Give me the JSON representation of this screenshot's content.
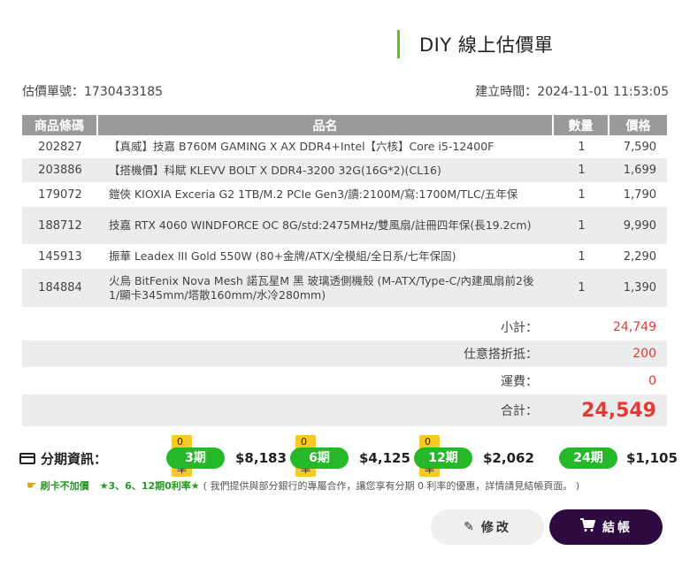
{
  "header": {
    "title": "DIY 線上估價單"
  },
  "quote": {
    "number": "估價單號：1730433185",
    "created": "建立時間：2024-11-01 11:53:05"
  },
  "table": {
    "columns": [
      "商品條碼",
      "品名",
      "數量",
      "價格"
    ],
    "rows": [
      {
        "code": "202827",
        "name": "【真威】技嘉 B760M GAMING X AX DDR4+Intel【六核】Core i5-12400F",
        "qty": "1",
        "price": "7,590"
      },
      {
        "code": "203886",
        "name": "【搭機價】科賦 KLEVV BOLT X DDR4-3200 32G(16G*2)(CL16)",
        "qty": "1",
        "price": "1,699"
      },
      {
        "code": "179072",
        "name": "鎧俠 KIOXIA Exceria G2 1TB/M.2 PCIe Gen3/讀:2100M/寫:1700M/TLC/五年保",
        "qty": "1",
        "price": "1,790"
      },
      {
        "code": "188712",
        "name": "技嘉 RTX 4060 WINDFORCE OC 8G/std:2475MHz/雙風扇/註冊四年保(長19.2cm)",
        "qty": "1",
        "price": "9,990"
      },
      {
        "code": "145913",
        "name": "振華 Leadex III Gold 550W (80+金牌/ATX/全模組/全日系/七年保固)",
        "qty": "1",
        "price": "2,290"
      },
      {
        "code": "184884",
        "name": "火鳥 BitFenix Nova Mesh 諾瓦星M 黑 玻璃透側機殼 (M-ATX/Type-C/內建風扇前2後1/顯卡345mm/塔散160mm/水冷280mm)",
        "qty": "1",
        "price": "1,390"
      }
    ]
  },
  "summary": {
    "subtotal_label": "小計：",
    "subtotal": "24,749",
    "discount_label": "仕意搭折抵：",
    "discount": "200",
    "shipping_label": "運費：",
    "shipping": "0",
    "total_label": "合計：",
    "total": "24,549"
  },
  "installment": {
    "label": "分期資訊：",
    "plans": [
      {
        "tag": "0利率",
        "term": "3期",
        "amount": "$8,183"
      },
      {
        "tag": "0利率",
        "term": "6期",
        "amount": "$4,125"
      },
      {
        "tag": "0利率",
        "term": "12期",
        "amount": "$2,062"
      },
      {
        "tag": "",
        "term": "24期",
        "amount": "$1,105"
      }
    ],
    "note_a": "刷卡不加價",
    "note_b": "★3、6、12期0利率★",
    "note_c": "( 我們提供與部分銀行的專屬合作，讓您享有分期 0 利率的優惠，詳情請見結帳頁面。 )"
  },
  "actions": {
    "edit": "修改",
    "checkout": "結帳"
  },
  "icons": {
    "edit": "pencil-icon",
    "checkout": "cart-icon",
    "installment": "credit-card-icon",
    "note": "hand-point-icon"
  },
  "colors": {
    "accent_green": "#25b828",
    "price_red": "#e53935",
    "checkout_bg": "#2d0a3f",
    "zero_tag": "#f6c928"
  }
}
